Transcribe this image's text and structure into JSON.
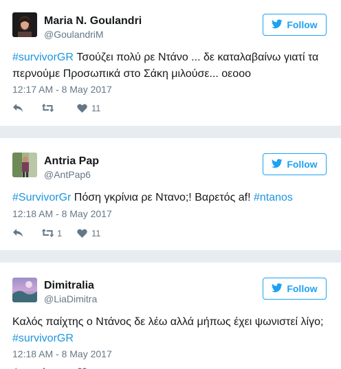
{
  "tweets": [
    {
      "name": "Maria N. Goulandri",
      "handle": "@GoulandriM",
      "follow_label": "Follow",
      "text_line1": "",
      "text_hashtag": "#survivorGR",
      "text_rest": " Τσούζει πολύ ρε Ντάνο ... δε καταλαβαίνω γιατί τα περνούμε Προσωπικά στο Σάκη μιλούσε... οεοοο",
      "time": "12:17 AM - 8 May 2017",
      "retweets": "",
      "likes": "11"
    },
    {
      "name": "Antria Pap",
      "handle": "@AntPap6",
      "follow_label": "Follow",
      "text_hashtag": "#SurvivorGr",
      "text_rest": " Πόση γκρίνια ρε Ντανο;! Βαρετός af! ",
      "text_hashtag2": "#ntanos",
      "time": "12:18 AM - 8 May 2017",
      "retweets": "1",
      "likes": "11"
    },
    {
      "name": "Dimitralia",
      "handle": "@LiaDimitra",
      "follow_label": "Follow",
      "text_rest": "Καλός παίχτης ο Ντάνος δε λέω αλλά μήπως έχει ψωνιστεί λίγο;",
      "text_hashtag": "#survivorGR",
      "time": "12:18 AM - 8 May 2017"
    }
  ],
  "colors": {
    "accent": "#1da1f2",
    "hashtag": "#1b95e0",
    "muted": "#657786",
    "background": "#e6ecf0"
  },
  "icons": [
    "twitter-bird-icon",
    "reply-icon",
    "retweet-icon",
    "heart-icon"
  ]
}
